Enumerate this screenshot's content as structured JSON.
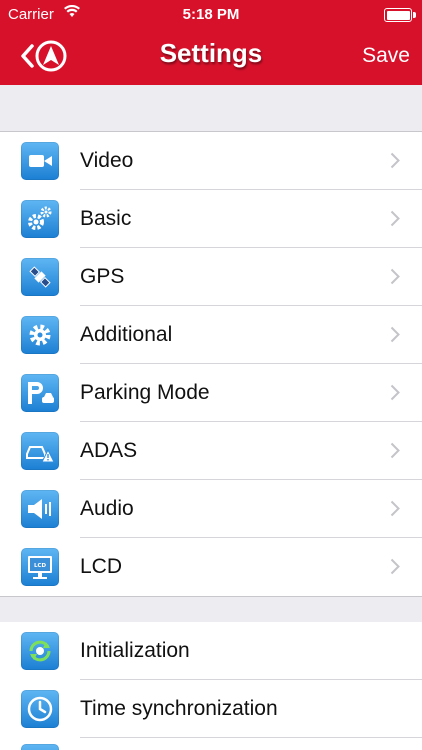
{
  "status_bar": {
    "carrier": "Carrier",
    "time": "5:18 PM"
  },
  "header": {
    "title": "Settings",
    "save_label": "Save",
    "accent_color": "#d8112b"
  },
  "group1": [
    {
      "label": "Video",
      "icon": "video-camera-icon"
    },
    {
      "label": "Basic",
      "icon": "gears-icon"
    },
    {
      "label": "GPS",
      "icon": "satellite-icon"
    },
    {
      "label": "Additional",
      "icon": "gear-icon"
    },
    {
      "label": "Parking Mode",
      "icon": "parking-icon"
    },
    {
      "label": "ADAS",
      "icon": "car-warning-icon"
    },
    {
      "label": "Audio",
      "icon": "speaker-icon"
    },
    {
      "label": "LCD",
      "icon": "monitor-icon"
    }
  ],
  "group2": [
    {
      "label": "Initialization",
      "icon": "reset-icon"
    },
    {
      "label": "Time synchronization",
      "icon": "clock-icon"
    }
  ]
}
